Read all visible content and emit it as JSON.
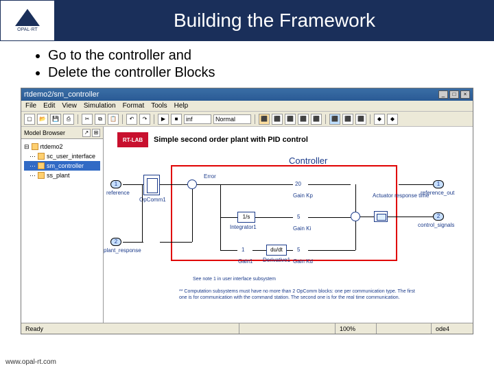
{
  "slide": {
    "title": "Building the Framework",
    "logo_text": "OPAL-RT",
    "bullets": [
      "Go to the controller and",
      "Delete the controller Blocks"
    ],
    "footer": "www.opal-rt.com"
  },
  "window": {
    "title": "rtdemo2/sm_controller",
    "menu": [
      "File",
      "Edit",
      "View",
      "Simulation",
      "Format",
      "Tools",
      "Help"
    ],
    "sim_time": "inf",
    "sim_mode": "Normal"
  },
  "sidebar": {
    "header": "Model Browser",
    "root": "rtdemo2",
    "items": [
      "sc_user_interface",
      "sm_controller",
      "ss_plant"
    ],
    "selected": "sm_controller"
  },
  "canvas": {
    "rt_logo": "RT-LAB",
    "rt_title": "Simple second order plant with PID control",
    "controller_label": "Controller",
    "labels": {
      "reference": "reference",
      "plant_response": "plant_response",
      "opcomm1": "OpComm1",
      "error": "Error",
      "gain_kp": "Gain Kp",
      "integrator1": "Integrator1",
      "gain_ki": "Gain Ki",
      "gain1": "Gain1",
      "derivative1": "Derivative1",
      "gain_kd": "Gain Kd",
      "actuator": "Actuator\nresponse time",
      "ref_out": "reference_out",
      "ctrl_signals": "control_signals",
      "int_block": "1/s",
      "deriv_block": "du/dt",
      "kp_val": "20",
      "ki_val": "5",
      "kd_val": "5",
      "gain1_val": "1",
      "port1": "1",
      "port2": "2",
      "note1": "See note 1 in user interface subsystem",
      "note2": "** Computation subsystems must have no more than 2 OpComm blocks: one per communication type. The first\none is for communication with the command station. The second one is for the real time communication."
    }
  },
  "status": {
    "ready": "Ready",
    "zoom": "100%",
    "solver": "ode4"
  }
}
